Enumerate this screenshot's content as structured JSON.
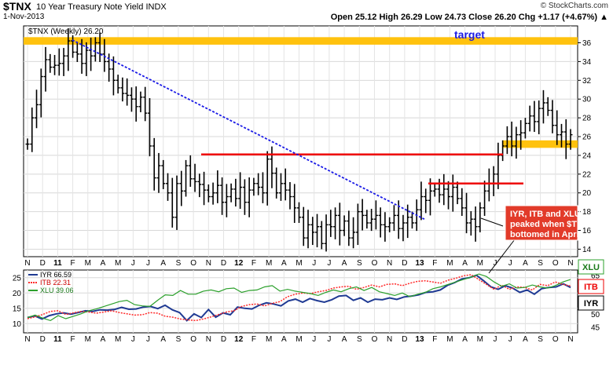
{
  "header": {
    "symbol": "$TNX",
    "description": "10 Year Treasury Note Yield",
    "exchange": "INDX",
    "date": "1-Nov-2013",
    "watermark": "© StockCharts.com",
    "ohlc": "Open 25.12   High 26.29   Low 24.73   Close 26.20   Chg +1.17 (+4.67%) ▲"
  },
  "colors": {
    "target_band": "#FFC20E",
    "resistance_line": "#EE0000",
    "trendline": "#1A1AE6",
    "iyr": "#1F3A93",
    "itb": "#FF2A2A",
    "xlu": "#2CA02C",
    "price_bar": "#000000"
  },
  "chart_data": [
    {
      "type": "ohlc",
      "legend": "$TNX (Weekly) 26.20",
      "y_ticks": [
        14,
        16,
        18,
        20,
        22,
        24,
        26,
        28,
        30,
        32,
        34,
        36
      ],
      "ylim": [
        13.2,
        37.8
      ],
      "x_ticks": [
        "N",
        "D",
        "11",
        "F",
        "M",
        "A",
        "M",
        "J",
        "J",
        "A",
        "S",
        "O",
        "N",
        "D",
        "12",
        "F",
        "M",
        "A",
        "M",
        "J",
        "J",
        "A",
        "S",
        "O",
        "N",
        "D",
        "13",
        "F",
        "M",
        "A",
        "M",
        "J",
        "J",
        "A",
        "S",
        "O",
        "N"
      ],
      "closes": [
        25.2,
        28.0,
        29.4,
        32.4,
        34.2,
        33.4,
        33.6,
        33.8,
        34.6,
        36.2,
        35.0,
        34.8,
        33.8,
        35.2,
        34.6,
        36.0,
        34.8,
        34.0,
        33.2,
        32.0,
        31.2,
        30.6,
        30.4,
        30.0,
        29.2,
        30.2,
        28.5,
        25.0,
        21.6,
        22.9,
        21.0,
        20.0,
        17.4,
        21.0,
        20.2,
        22.9,
        21.5,
        21.2,
        20.9,
        20.3,
        19.6,
        20.0,
        20.8,
        19.0,
        19.6,
        20.4,
        19.4,
        20.6,
        19.0,
        20.3,
        21.0,
        20.6,
        20.0,
        23.6,
        22.1,
        20.0,
        21.0,
        20.3,
        19.6,
        18.4,
        17.4,
        15.2,
        16.6,
        15.8,
        16.4,
        14.6,
        16.6,
        16.4,
        17.6,
        16.0,
        17.0,
        15.2,
        15.8,
        18.0,
        17.6,
        16.8,
        17.2,
        17.6,
        16.6,
        16.4,
        16.8,
        17.6,
        16.2,
        16.8,
        17.4,
        16.8,
        18.2,
        19.6,
        19.2,
        20.2,
        20.4,
        19.8,
        20.4,
        19.6,
        20.6,
        19.4,
        18.4,
        16.8,
        17.2,
        16.4,
        18.4,
        20.2,
        21.0,
        22.0,
        24.0,
        25.0,
        26.0,
        25.0,
        26.2,
        26.4,
        27.4,
        28.2,
        27.6,
        29.0,
        29.6,
        28.8,
        27.2,
        26.2,
        26.5,
        25.2,
        26.2
      ],
      "annotations": [
        {
          "text": "target",
          "type": "horizontal_band",
          "from": 35.8,
          "to": 36.6
        },
        {
          "text": "",
          "type": "horizontal_band",
          "from": 24.8,
          "to": 25.6
        },
        {
          "type": "resistance_line",
          "y": 24.1
        },
        {
          "type": "resistance_line",
          "y": 21.0
        },
        {
          "type": "trendline",
          "from_y": 36.3,
          "to_y": 17.2
        }
      ]
    },
    {
      "type": "line",
      "y_ticks_left": [
        10,
        15,
        20,
        25
      ],
      "y_ticks_right": [
        45,
        50,
        55,
        60,
        65
      ],
      "series": [
        {
          "name": "IYR",
          "value": "66.59",
          "label": "IYR  66.59",
          "tag": "IYR",
          "values": [
            12.0,
            12.5,
            11.5,
            12.6,
            13.2,
            13.5,
            13.1,
            13.6,
            14.2,
            14.0,
            14.5,
            14.4,
            14.6,
            15.3,
            14.7,
            14.8,
            15.4,
            15.6,
            14.9,
            16.0,
            14.5,
            13.6,
            11.0,
            13.2,
            12.0,
            14.6,
            12.1,
            13.5,
            12.9,
            15.4,
            15.0,
            14.8,
            16.0,
            16.8,
            16.4,
            15.8,
            17.4,
            18.0,
            17.0,
            18.2,
            17.5,
            17.0,
            17.8,
            19.0,
            19.2,
            17.6,
            18.4,
            17.0,
            18.0,
            17.8,
            18.4,
            17.9,
            18.7,
            19.0,
            19.4,
            20.2,
            20.4,
            21.0,
            22.5,
            23.4,
            24.6,
            25.0,
            25.8,
            24.0,
            22.0,
            21.2,
            22.4,
            21.6,
            20.2,
            21.0,
            19.6,
            21.4,
            21.8,
            22.0,
            23.0,
            21.8
          ]
        },
        {
          "name": "ITB",
          "value": "22.31",
          "label": "ITB  22.31",
          "tag": "ITB",
          "values": [
            11.6,
            12.2,
            13.0,
            14.0,
            14.2,
            13.0,
            13.5,
            14.0,
            13.8,
            13.4,
            13.8,
            14.2,
            13.6,
            13.2,
            12.8,
            12.9,
            13.6,
            13.4,
            12.4,
            12.1,
            11.5,
            11.2,
            11.0,
            11.5,
            12.2,
            13.0,
            13.8,
            14.2,
            15.6,
            16.2,
            16.4,
            15.8,
            16.6,
            17.2,
            18.8,
            19.6,
            20.0,
            19.8,
            20.4,
            20.8,
            21.6,
            22.0,
            22.2,
            21.2,
            21.8,
            22.6,
            22.0,
            22.8,
            23.0,
            22.4,
            23.2,
            23.8,
            24.0,
            23.6,
            23.2,
            24.2,
            24.8,
            25.6,
            26.0,
            24.4,
            22.8,
            21.2,
            22.6,
            21.2,
            22.0,
            21.8,
            21.0,
            22.8,
            22.4,
            23.6,
            22.8,
            22.3
          ]
        },
        {
          "name": "XLU",
          "value": "39.06",
          "label": "XLU  39.06",
          "tag": "XLU",
          "values": [
            12.0,
            12.8,
            11.8,
            11.0,
            12.6,
            11.6,
            12.4,
            13.2,
            14.2,
            14.8,
            15.6,
            16.4,
            17.2,
            17.6,
            16.2,
            15.8,
            15.6,
            17.6,
            19.4,
            19.2,
            20.8,
            19.6,
            19.6,
            20.6,
            21.0,
            20.4,
            21.4,
            21.6,
            20.2,
            20.8,
            21.0,
            22.0,
            22.4,
            20.6,
            21.2,
            20.6,
            20.2,
            19.8,
            19.2,
            20.2,
            21.0,
            20.4,
            21.4,
            22.0,
            20.8,
            21.8,
            20.4,
            19.8,
            19.2,
            20.0,
            18.8,
            19.6,
            20.2,
            21.4,
            22.0,
            22.8,
            23.6,
            24.4,
            25.2,
            26.2,
            25.4,
            23.6,
            22.2,
            23.0,
            21.6,
            21.8,
            22.6,
            22.0,
            21.6,
            22.4,
            23.6,
            24.4
          ]
        }
      ]
    }
  ],
  "annotation_box": "IYR, ITB and XLU peaked when $TNX bottomed in April",
  "target_label": "target"
}
